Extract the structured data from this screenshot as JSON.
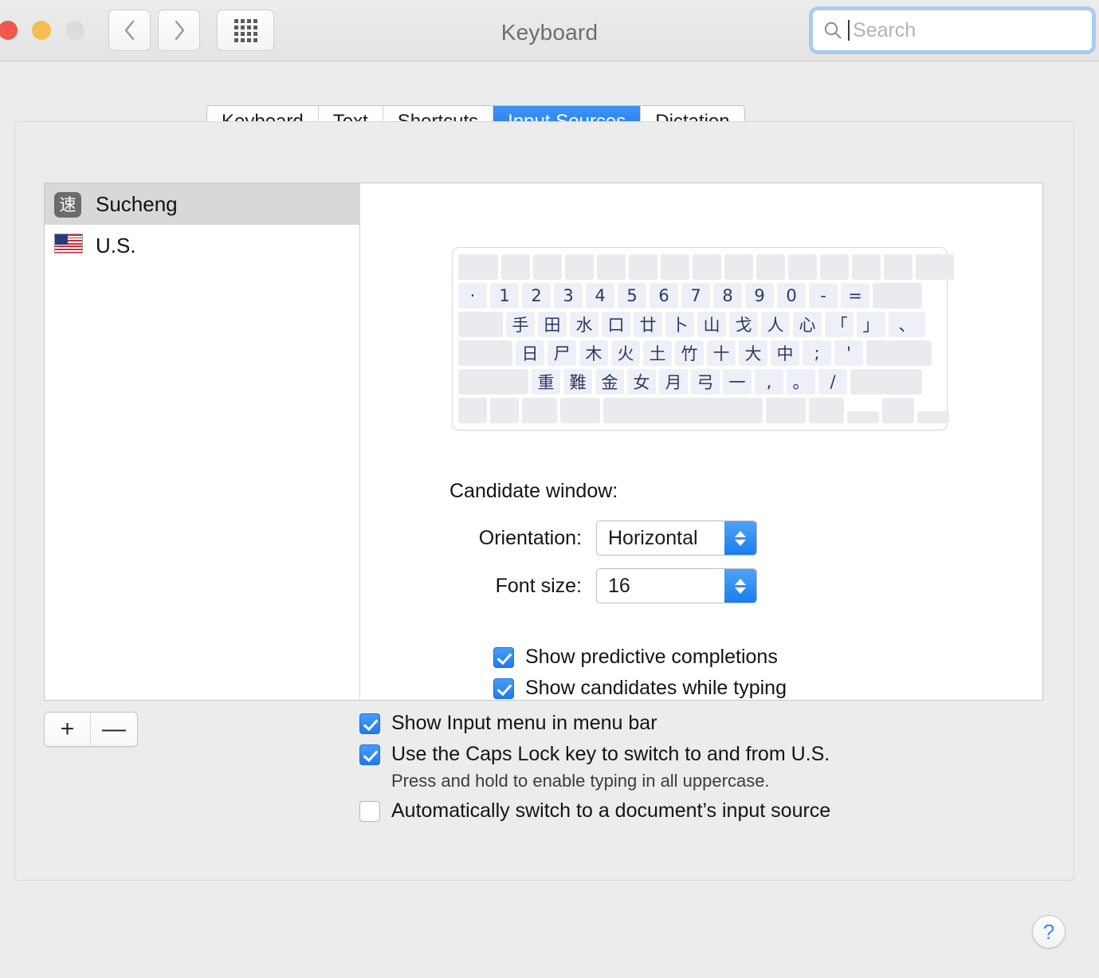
{
  "window": {
    "title": "Keyboard",
    "traffic_lights": [
      "close",
      "minimize",
      "zoom"
    ],
    "nav": {
      "back": "back-arrow",
      "forward": "forward-arrow",
      "grid": "show-all-grid"
    }
  },
  "search": {
    "placeholder": "Search",
    "value": "",
    "icon": "search-icon"
  },
  "tabs": [
    {
      "label": "Keyboard",
      "selected": false
    },
    {
      "label": "Text",
      "selected": false
    },
    {
      "label": "Shortcuts",
      "selected": false
    },
    {
      "label": "Input Sources",
      "selected": true
    },
    {
      "label": "Dictation",
      "selected": false
    }
  ],
  "input_sources": [
    {
      "label": "Sucheng",
      "icon": "cjk-badge-icon",
      "glyph": "速",
      "selected": true
    },
    {
      "label": "U.S.",
      "icon": "us-flag-icon",
      "glyph": "",
      "selected": false
    }
  ],
  "list_buttons": {
    "add": "+",
    "remove": "—"
  },
  "keyboard_preview": {
    "rows": [
      {
        "indent": 0,
        "keys": [
          "",
          "",
          "",
          "",
          "",
          "",
          "",
          "",
          "",
          "",
          "",
          "",
          "",
          ""
        ]
      },
      {
        "indent": 0,
        "keys": [
          "·",
          "1",
          "2",
          "3",
          "4",
          "5",
          "6",
          "7",
          "8",
          "9",
          "0",
          "-",
          "=",
          ""
        ]
      },
      {
        "indent": 0,
        "keys": [
          "",
          "手",
          "田",
          "水",
          "口",
          "廿",
          "卜",
          "山",
          "戈",
          "人",
          "心",
          "「",
          "」",
          "、"
        ]
      },
      {
        "indent": 0,
        "keys": [
          "",
          "日",
          "尸",
          "木",
          "火",
          "土",
          "竹",
          "十",
          "大",
          "中",
          ";",
          "'",
          ""
        ]
      },
      {
        "indent": 0,
        "keys": [
          "",
          "重",
          "難",
          "金",
          "女",
          "月",
          "弓",
          "一",
          ",",
          "。",
          "/",
          ""
        ]
      },
      {
        "indent": 0,
        "keys": [
          "",
          "",
          "",
          "",
          "",
          "",
          "",
          "",
          ""
        ]
      }
    ]
  },
  "candidate_window": {
    "title": "Candidate window:",
    "orientation": {
      "label": "Orientation:",
      "value": "Horizontal"
    },
    "font_size": {
      "label": "Font size:",
      "value": "16"
    },
    "checkboxes": [
      {
        "label": "Show predictive completions",
        "checked": true
      },
      {
        "label": "Show candidates while typing",
        "checked": true
      }
    ]
  },
  "global_options": {
    "show_input_menu": {
      "label": "Show Input menu in menu bar",
      "checked": true
    },
    "caps_lock_switch": {
      "label": "Use the Caps Lock key to switch to and from U.S.",
      "checked": true
    },
    "caps_lock_note": "Press and hold to enable typing in all uppercase.",
    "auto_switch": {
      "label": "Automatically switch to a document’s input source",
      "checked": false
    }
  },
  "help": {
    "label": "?",
    "icon": "help-icon"
  },
  "colors": {
    "accent": "#1e7bf0",
    "selected_tab_bg": "#3f92f3",
    "window_bg": "#ececec",
    "key_bg": "#edf0f7",
    "key_text": "#2d3a66",
    "list_selected_bg": "#d8d8d8"
  }
}
